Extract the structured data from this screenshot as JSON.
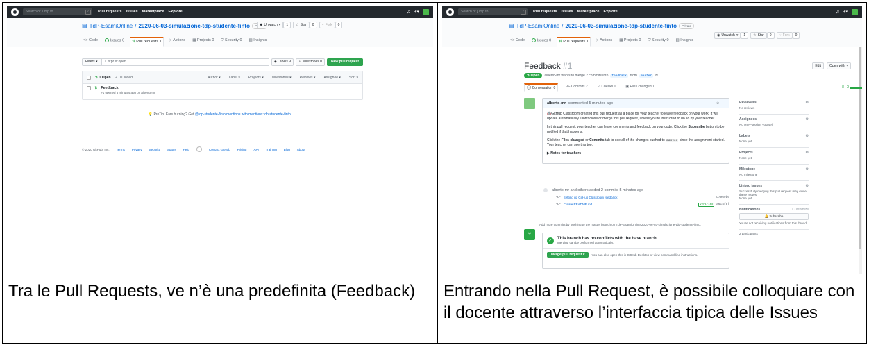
{
  "captions": {
    "left": "Tra le Pull Requests, ve n’è una predefinita (Feedback)",
    "right": "Entrando nella Pull Request, è possibile colloquiare con il docente attraverso l’interfaccia tipica delle Issues"
  },
  "github": {
    "search_placeholder": "Search or jump to...",
    "slash": "/",
    "nav": [
      "Pull requests",
      "Issues",
      "Marketplace",
      "Explore"
    ],
    "owner": "TdP-EsamiOnline",
    "repo": "2020-06-03-simulazione-tdp-studente-finto",
    "private": "Private",
    "watch": "Unwatch",
    "watch_count": "1",
    "star": "Star",
    "star_count": "0",
    "fork": "Fork",
    "fork_count": "0",
    "tabs": {
      "code": "Code",
      "issues": "Issues",
      "issues_count": "0",
      "pulls": "Pull requests",
      "pulls_count": "1",
      "actions": "Actions",
      "projects": "Projects",
      "projects_count": "0",
      "security": "Security",
      "security_count": "0",
      "insights": "Insights"
    }
  },
  "left": {
    "filters": "Filters",
    "filter_value": "is:pr is:open",
    "labels": "Labels",
    "labels_count": "9",
    "milestones": "Milestones",
    "milestones_count": "0",
    "new_pr": "New pull request",
    "open": "1 Open",
    "closed": "0 Closed",
    "sorts": [
      "Author",
      "Label",
      "Projects",
      "Milestones",
      "Reviews",
      "Assignee",
      "Sort"
    ],
    "pr_title": "Feedback",
    "pr_meta": "#1 opened 5 minutes ago by alberto-mr",
    "protip_prefix": "ProTip! Ears burning? Get ",
    "protip_link": "@tdp-studente-finto mentions with mentions:tdp-studente-finto",
    "protip_suffix": ".",
    "footer_copy": "© 2020 GitHub, Inc.",
    "footer_links": [
      "Terms",
      "Privacy",
      "Security",
      "Status",
      "Help"
    ],
    "footer_links_right": [
      "Contact GitHub",
      "Pricing",
      "API",
      "Training",
      "Blog",
      "About"
    ]
  },
  "right": {
    "pr_title": "Feedback",
    "pr_number": "#1",
    "edit": "Edit",
    "open_with": "Open with",
    "open_badge": "Open",
    "state_text_1": "alberto-mr wants to merge 2 commits into",
    "base_branch": "feedback",
    "state_text_2": "from",
    "head_branch": "master",
    "tabs": {
      "conversation": "Conversation",
      "conversation_count": "0",
      "commits": "Commits",
      "commits_count": "2",
      "checks": "Checks",
      "checks_count": "0",
      "files": "Files changed",
      "files_count": "1"
    },
    "diffstat": "+8 −0",
    "comment_author": "alberto-mr",
    "comment_time": "commented 5 minutes ago",
    "comment_dots": "···",
    "p1": "GitHub Classroom created this pull request as a place for your teacher to leave feedback on your work. It will update automatically. Don’t close or merge this pull request, unless you’re instructed to do so by your teacher.",
    "p2a": "In this pull request, your teacher can leave comments and feedback on your code. Click the ",
    "p2b": "Subscribe",
    "p2c": " button to be notified if that happens.",
    "p3a": "Click the ",
    "p3b": "Files changed",
    "p3c": " or ",
    "p3d": "Commits",
    "p3e": " tab to see all of the changes pushed to ",
    "p3code": "master",
    "p3f": " since the assignment started. Your teacher can see this too.",
    "notes": "Notes for teachers",
    "tl_text": "alberto-mr and others added 2 commits 5 minutes ago",
    "commit1": "Setting up GitHub Classroom feedback",
    "commit1_sha": "d7969b6",
    "commit2": "Create README.md",
    "commit2_verified": "Verified",
    "commit2_sha": "a6c4f8f",
    "push_hint": "Add more commits by pushing to the master branch on TdP-EsamiOnline/2020-06-03-simulazione-tdp-studente-finto.",
    "merge_title": "This branch has no conflicts with the base branch",
    "merge_sub": "Merging can be performed automatically.",
    "merge_btn": "Merge pull request",
    "merge_hint": "You can also open this in GitHub Desktop or view command line instructions.",
    "sidebar": {
      "reviewers": "Reviewers",
      "reviewers_v": "No reviews",
      "assignees": "Assignees",
      "assignees_v": "No one—assign yourself",
      "labels": "Labels",
      "labels_v": "None yet",
      "projects": "Projects",
      "projects_v": "None yet",
      "milestone": "Milestone",
      "milestone_v": "No milestone",
      "linked": "Linked issues",
      "linked_v": "Successfully merging this pull request may close these issues.",
      "linked_v2": "None yet",
      "notifications": "Notifications",
      "customize": "Customize",
      "subscribe": "Subscribe",
      "notif_v": "You’re not receiving notifications from this thread.",
      "participants": "2 participants"
    }
  }
}
